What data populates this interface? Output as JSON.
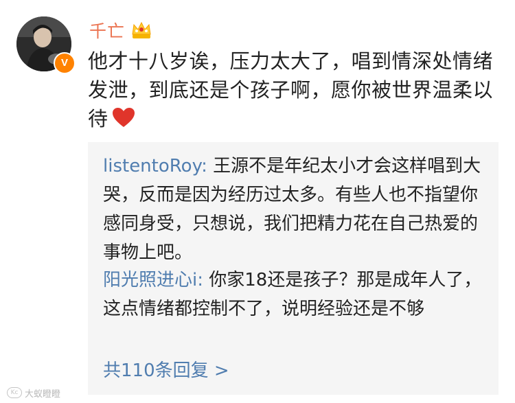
{
  "post": {
    "username": "千亡",
    "verified_badge": "V",
    "text": "他才十八岁诶，压力太大了，唱到情深处情绪发泄，到底还是个孩子啊，愿你被世界温柔以待",
    "emoji": "red-heart-icon"
  },
  "replies": [
    {
      "author": "listentoRoy:",
      "text": " 王源不是年纪太小才会这样唱到大哭，反而是因为经历过太多。有些人也不指望你感同身受，只想说，我们把精力花在自己热爱的事物上吧。"
    },
    {
      "author": "阳光照进心i:",
      "text": " 你家18还是孩子？那是成年人了，这点情绪都控制不了，说明经验还是不够"
    }
  ],
  "more_replies_label": "共110条回复 >",
  "watermark": {
    "text": "大蚁瞪瞪",
    "icon_text": "Kc"
  },
  "colors": {
    "username": "#eb7350",
    "link": "#507daf",
    "reply_bg": "#f5f5f5",
    "badge": "#ff8200",
    "heart": "#e0352b"
  }
}
